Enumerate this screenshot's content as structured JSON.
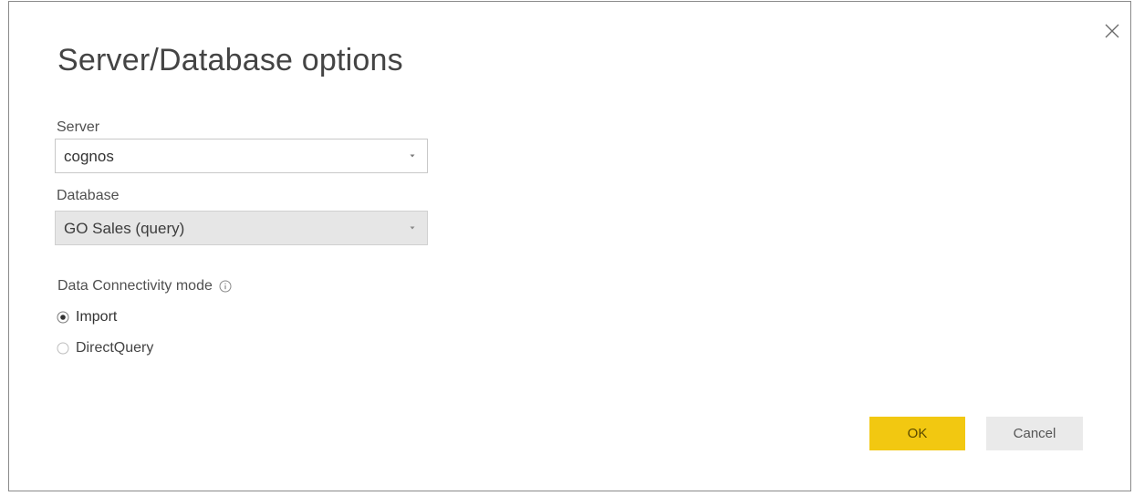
{
  "dialog": {
    "title": "Server/Database options",
    "close_icon": "close-icon"
  },
  "server": {
    "label": "Server",
    "value": "cognos"
  },
  "database": {
    "label": "Database",
    "value": "GO Sales (query)",
    "disabled": true
  },
  "connectivity": {
    "label": "Data Connectivity mode",
    "info_icon": "info-icon",
    "options": [
      {
        "label": "Import",
        "selected": true
      },
      {
        "label": "DirectQuery",
        "selected": false
      }
    ]
  },
  "buttons": {
    "ok_label": "OK",
    "cancel_label": "Cancel"
  },
  "colors": {
    "accent": "#f2c811",
    "cancel_bg": "#eaeaea",
    "disabled_field_bg": "#e6e6e6",
    "border": "#c8c8c8"
  }
}
